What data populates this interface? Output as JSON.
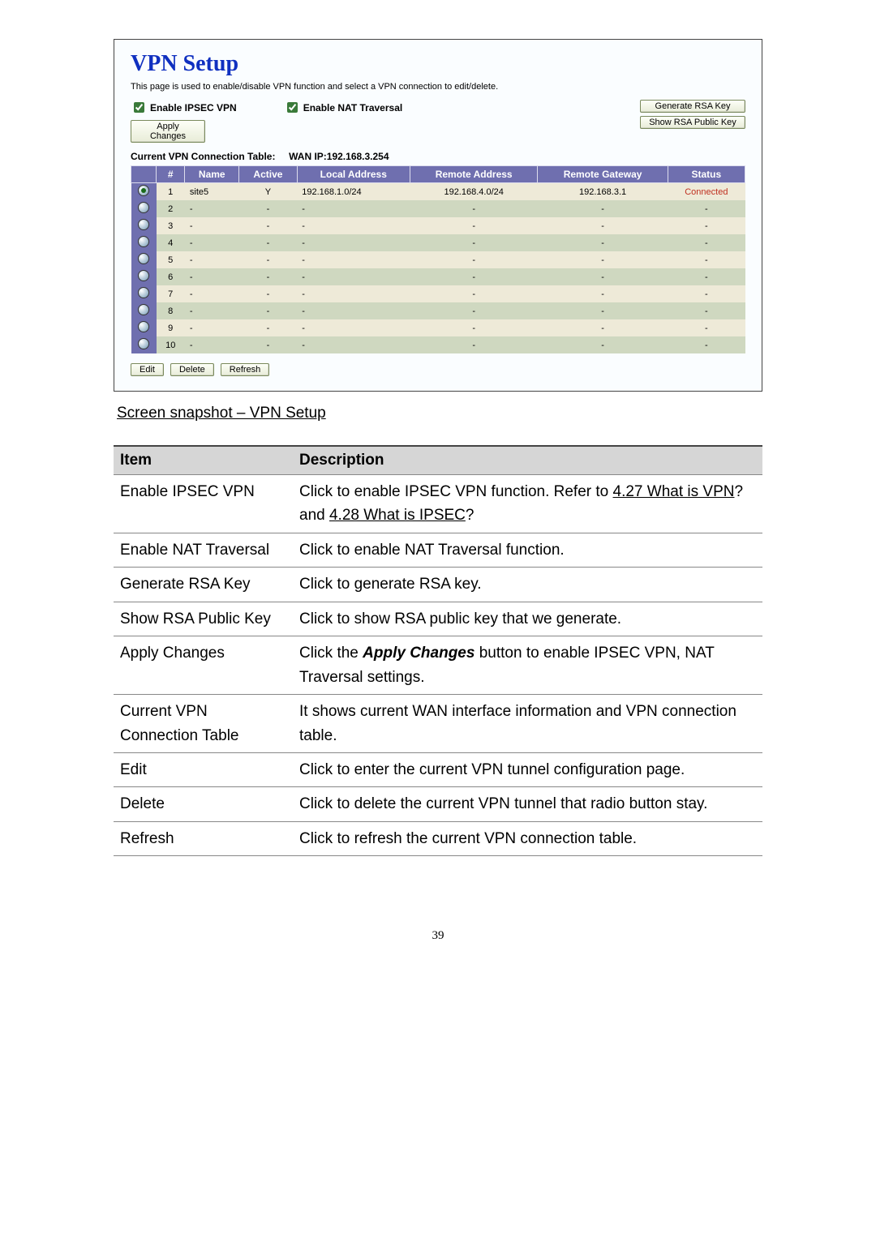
{
  "vpn": {
    "title": "VPN Setup",
    "desc": "This page is used to enable/disable VPN function and select a VPN connection to edit/delete.",
    "enable_ipsec": "Enable IPSEC VPN",
    "enable_nat": "Enable NAT Traversal",
    "gen_key": "Generate RSA Key",
    "show_key": "Show RSA Public Key",
    "apply": "Apply Changes",
    "table_label": "Current VPN Connection Table:",
    "wan_ip_label": "WAN IP:192.168.3.254",
    "headers": {
      "num": "#",
      "name": "Name",
      "active": "Active",
      "laddr": "Local Address",
      "raddr": "Remote Address",
      "rgw": "Remote Gateway",
      "status": "Status"
    },
    "rows": [
      {
        "n": "1",
        "name": "site5",
        "active": "Y",
        "laddr": "192.168.1.0/24",
        "raddr": "192.168.4.0/24",
        "rgw": "192.168.3.1",
        "status": "Connected",
        "sel": true
      },
      {
        "n": "2",
        "name": "-",
        "active": "-",
        "laddr": "-",
        "raddr": "-",
        "rgw": "-",
        "status": "-"
      },
      {
        "n": "3",
        "name": "-",
        "active": "-",
        "laddr": "-",
        "raddr": "-",
        "rgw": "-",
        "status": "-"
      },
      {
        "n": "4",
        "name": "-",
        "active": "-",
        "laddr": "-",
        "raddr": "-",
        "rgw": "-",
        "status": "-"
      },
      {
        "n": "5",
        "name": "-",
        "active": "-",
        "laddr": "-",
        "raddr": "-",
        "rgw": "-",
        "status": "-"
      },
      {
        "n": "6",
        "name": "-",
        "active": "-",
        "laddr": "-",
        "raddr": "-",
        "rgw": "-",
        "status": "-"
      },
      {
        "n": "7",
        "name": "-",
        "active": "-",
        "laddr": "-",
        "raddr": "-",
        "rgw": "-",
        "status": "-"
      },
      {
        "n": "8",
        "name": "-",
        "active": "-",
        "laddr": "-",
        "raddr": "-",
        "rgw": "-",
        "status": "-"
      },
      {
        "n": "9",
        "name": "-",
        "active": "-",
        "laddr": "-",
        "raddr": "-",
        "rgw": "-",
        "status": "-"
      },
      {
        "n": "10",
        "name": "-",
        "active": "-",
        "laddr": "-",
        "raddr": "-",
        "rgw": "-",
        "status": "-"
      }
    ],
    "edit": "Edit",
    "delete": "Delete",
    "refresh": "Refresh"
  },
  "caption": "Screen snapshot – VPN Setup",
  "table": {
    "h_item": "Item",
    "h_desc": "Description",
    "rows": [
      {
        "item": "Enable IPSEC VPN",
        "desc_pre": "Click to enable IPSEC VPN function. Refer to ",
        "link1": "4.27 What is VPN",
        "mid": "? and ",
        "link2": "4.28 What is IPSEC",
        "post": "?"
      },
      {
        "item": "Enable NAT Traversal",
        "desc": "Click to enable NAT Traversal function."
      },
      {
        "item": "Generate RSA Key",
        "desc": "Click to generate RSA key."
      },
      {
        "item": "Show RSA Public Key",
        "desc": "Click to show RSA public key that we generate."
      },
      {
        "item": "Apply Changes",
        "desc_prefix": "Click the ",
        "bold": "Apply Changes",
        "desc_suffix": " button to enable IPSEC VPN, NAT Traversal settings."
      },
      {
        "item": "Current VPN Connection Table",
        "desc": "It shows current WAN interface information and VPN connection table."
      },
      {
        "item": "Edit",
        "desc": "Click to enter the current VPN tunnel configuration page."
      },
      {
        "item": "Delete",
        "desc": "Click to delete the current VPN tunnel that radio button stay."
      },
      {
        "item": "Refresh",
        "desc": "Click to refresh the current VPN connection table."
      }
    ]
  },
  "page_number": "39"
}
